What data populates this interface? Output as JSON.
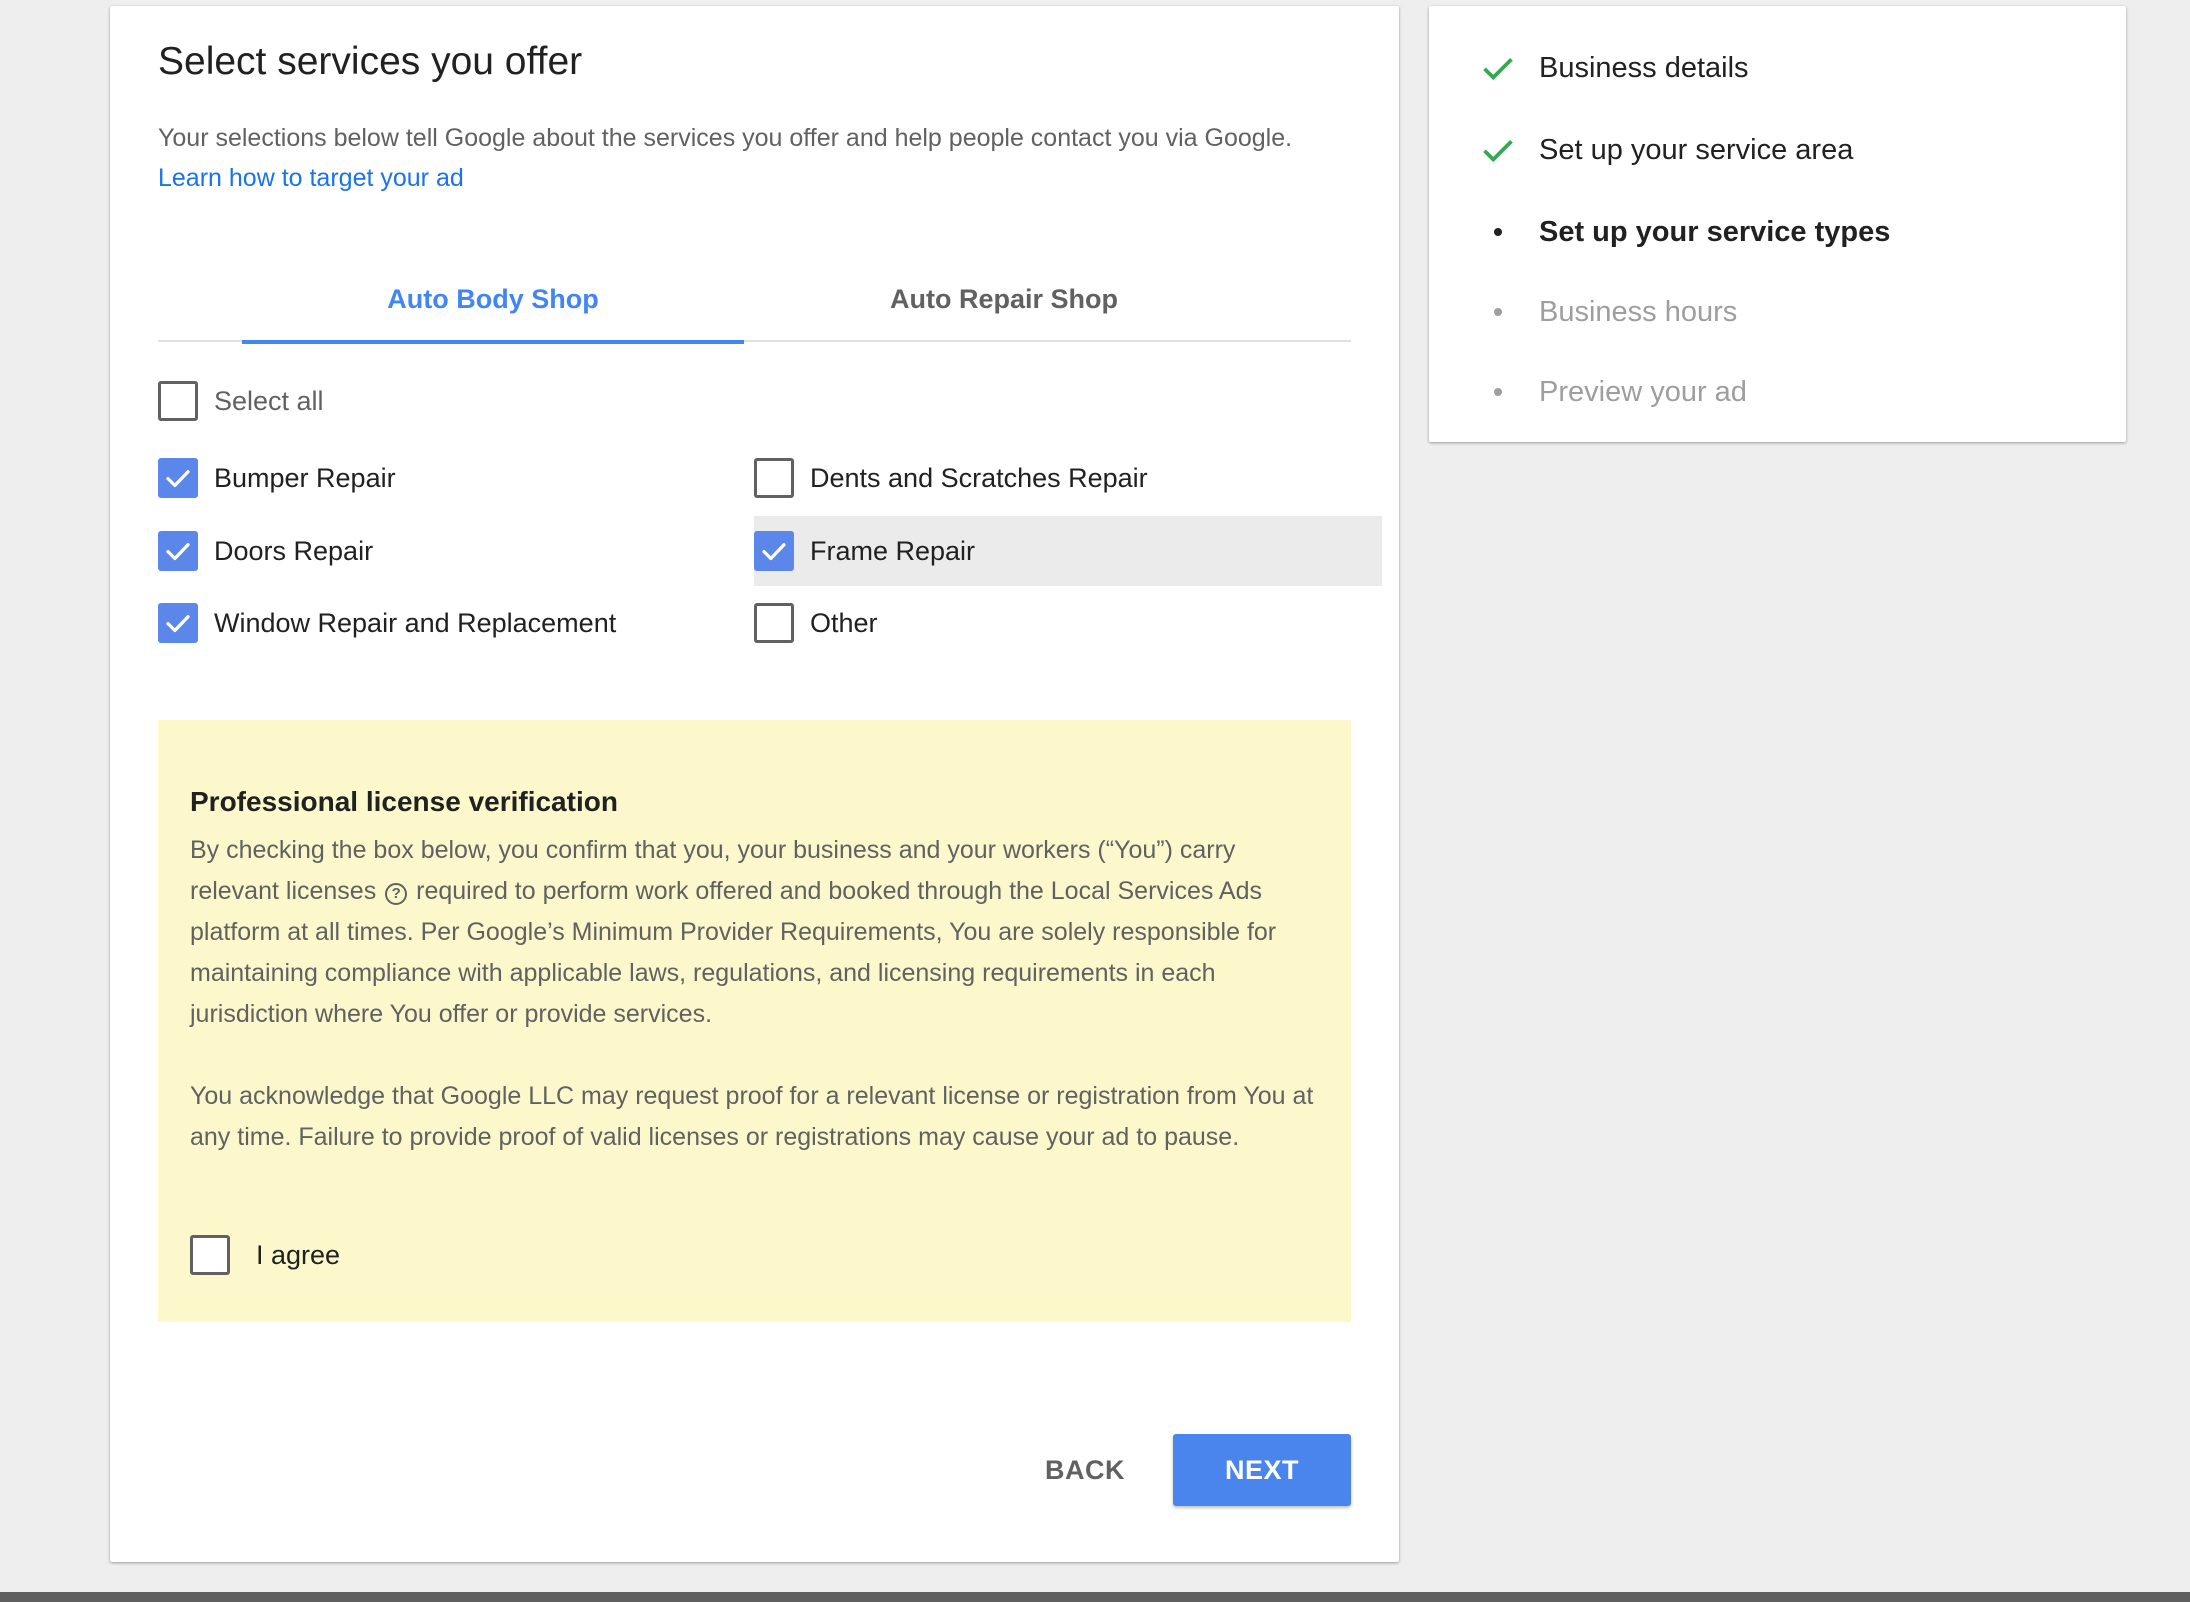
{
  "header": {
    "title": "Select services you offer",
    "subtitle": "Your selections below tell Google about the services you offer and help people contact you via Google.",
    "learn_link": "Learn how to target your ad"
  },
  "tabs": [
    {
      "label": "Auto Body Shop",
      "active": true
    },
    {
      "label": "Auto Repair Shop",
      "active": false
    }
  ],
  "services": {
    "select_all": {
      "label": "Select all",
      "checked": false
    },
    "items": [
      {
        "label": "Bumper Repair",
        "checked": true
      },
      {
        "label": "Dents and Scratches Repair",
        "checked": false
      },
      {
        "label": "Doors Repair",
        "checked": true
      },
      {
        "label": "Frame Repair",
        "checked": true
      },
      {
        "label": "Window Repair and Replacement",
        "checked": true
      },
      {
        "label": "Other",
        "checked": false
      }
    ]
  },
  "license": {
    "title": "Professional license verification",
    "p1_a": "By checking the box below, you confirm that you, your business and your workers (“You”) carry relevant licenses",
    "help_glyph": "?",
    "p1_b": "required to perform work offered and booked through the Local Services Ads platform at all times. Per Google’s Minimum Provider Requirements, You are solely responsible for maintaining compliance with applicable laws, regulations, and licensing requirements in each jurisdiction where You offer or provide services.",
    "p2": "You acknowledge that Google LLC may request proof for a relevant license or registration from You at any time. Failure to provide proof of valid licenses or registrations may cause your ad to pause.",
    "agree": {
      "label": "I agree",
      "checked": false
    }
  },
  "actions": {
    "back": "BACK",
    "next": "NEXT"
  },
  "steps": [
    {
      "label": "Business details",
      "state": "done"
    },
    {
      "label": "Set up your service area",
      "state": "done"
    },
    {
      "label": "Set up your service types",
      "state": "active"
    },
    {
      "label": "Business hours",
      "state": "future"
    },
    {
      "label": "Preview your ad",
      "state": "future"
    }
  ],
  "colors": {
    "accent": "#4285f4",
    "check_fill": "#5b86ea",
    "done_check": "#34a853",
    "notice_bg": "#fdf8cc"
  }
}
